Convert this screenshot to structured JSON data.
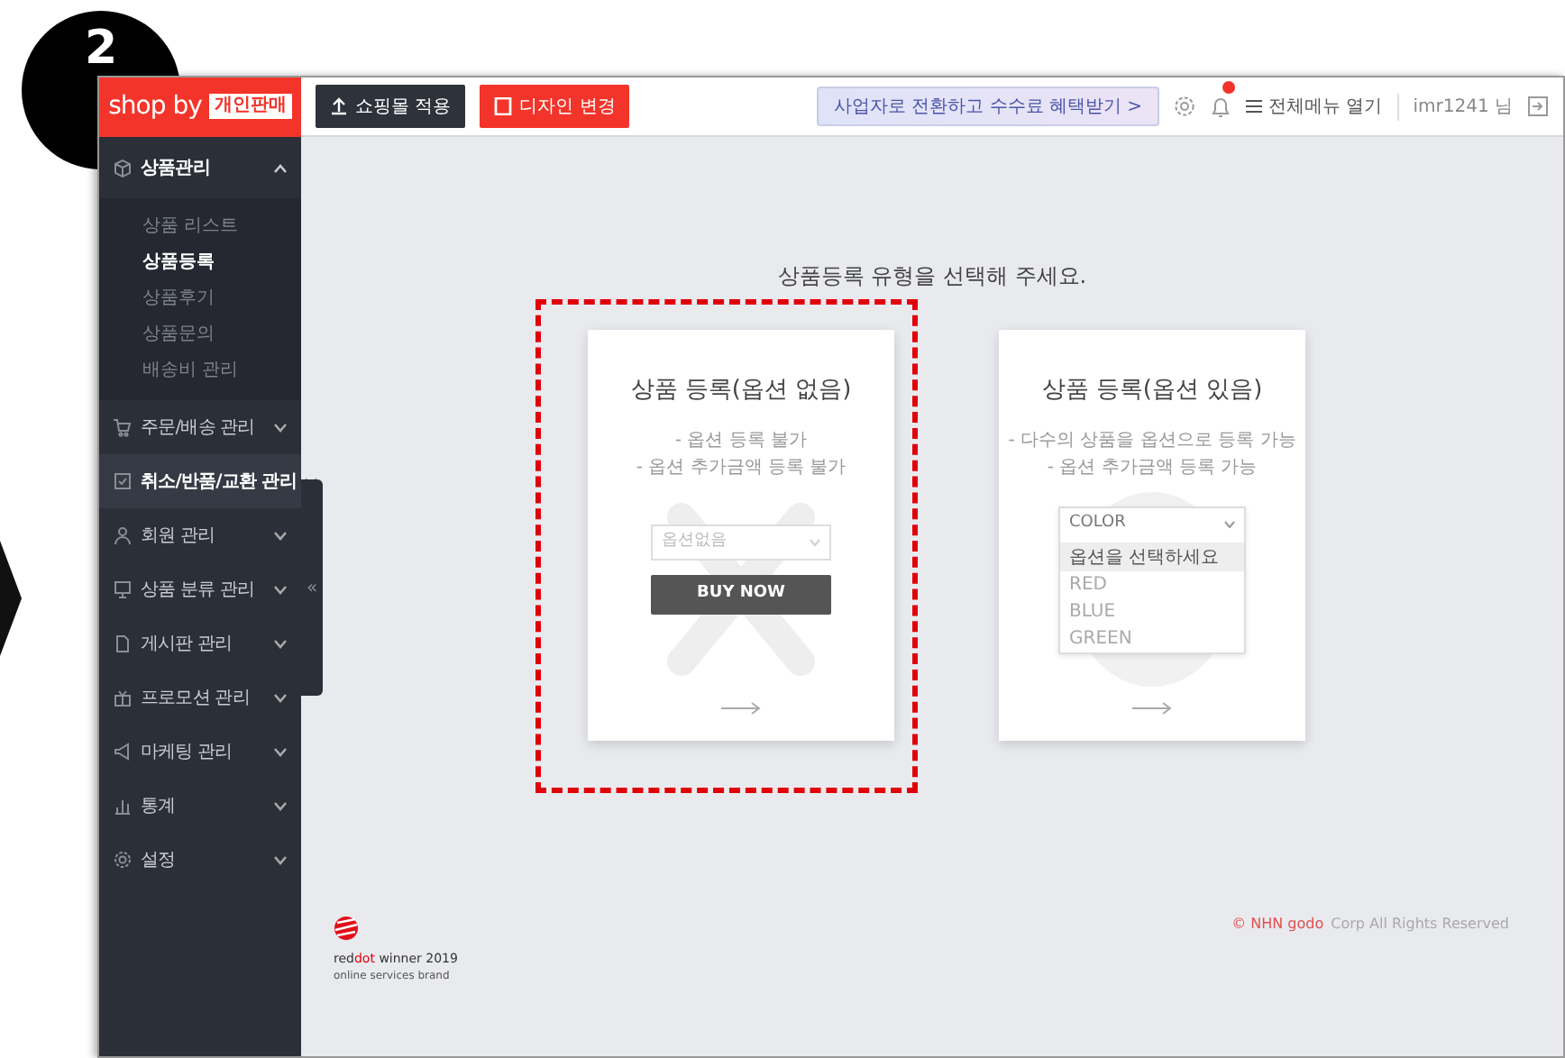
{
  "overlay": {
    "step_number": "2"
  },
  "top_bar": {
    "logo": "shop by",
    "logo_badge": "개인판매",
    "buttons": [
      {
        "label": "쇼핑몰 적용",
        "kind": "dark"
      },
      {
        "label": "디자인 변경",
        "kind": "accent"
      }
    ],
    "promo": "사업자로 전환하고 수수료 혜택받기 >",
    "notification_dot": true,
    "menu_label": "전체메뉴 열기",
    "user": "imr1241 님"
  },
  "sidebar": {
    "collapse_label": "«",
    "items": [
      {
        "label": "상품관리",
        "expanded": true,
        "selected": false,
        "children": [
          {
            "label": "상품 리스트",
            "selected": false
          },
          {
            "label": "상품등록",
            "selected": true
          },
          {
            "label": "상품후기",
            "selected": false
          },
          {
            "label": "상품문의",
            "selected": false
          },
          {
            "label": "배송비 관리",
            "selected": false
          }
        ]
      },
      {
        "label": "주문/배송 관리",
        "expanded": false,
        "selected": false
      },
      {
        "label": "취소/반품/교환 관리",
        "expanded": false,
        "selected": true
      },
      {
        "label": "회원 관리",
        "expanded": false,
        "selected": false
      },
      {
        "label": "상품 분류 관리",
        "expanded": false,
        "selected": false
      },
      {
        "label": "게시판 관리",
        "expanded": false,
        "selected": false
      },
      {
        "label": "프로모션 관리",
        "expanded": false,
        "selected": false
      },
      {
        "label": "마케팅 관리",
        "expanded": false,
        "selected": false
      },
      {
        "label": "통계",
        "expanded": false,
        "selected": false
      },
      {
        "label": "설정",
        "expanded": false,
        "selected": false
      }
    ]
  },
  "main": {
    "heading": "상품등록 유형을 선택해 주세요.",
    "cards": [
      {
        "kind": "no_option",
        "highlighted": true,
        "title": "상품 등록(옵션 없음)",
        "lines": [
          "- 옵션 등록 불가",
          "- 옵션 추가금액 등록 불가"
        ],
        "select_placeholder": "옵션없음",
        "button": "BUY NOW"
      },
      {
        "kind": "with_option",
        "highlighted": false,
        "title": "상품 등록(옵션 있음)",
        "lines": [
          "- 다수의 상품을 옵션으로 등록 가능",
          "- 옵션 추가금액 등록 가능"
        ],
        "select_value": "COLOR",
        "options": [
          {
            "label": "옵션을 선택하세요",
            "selected": true
          },
          {
            "label": "RED",
            "selected": false
          },
          {
            "label": "BLUE",
            "selected": false
          },
          {
            "label": "GREEN",
            "selected": false
          }
        ]
      }
    ]
  },
  "footer": {
    "award": {
      "prefix": "red",
      "highlight": "dot",
      "suffix": " winner 2019"
    },
    "award_sub": "online services brand",
    "copyright_brand": "© NHN godo",
    "copyright_rest": "Corp All Rights Reserved"
  }
}
